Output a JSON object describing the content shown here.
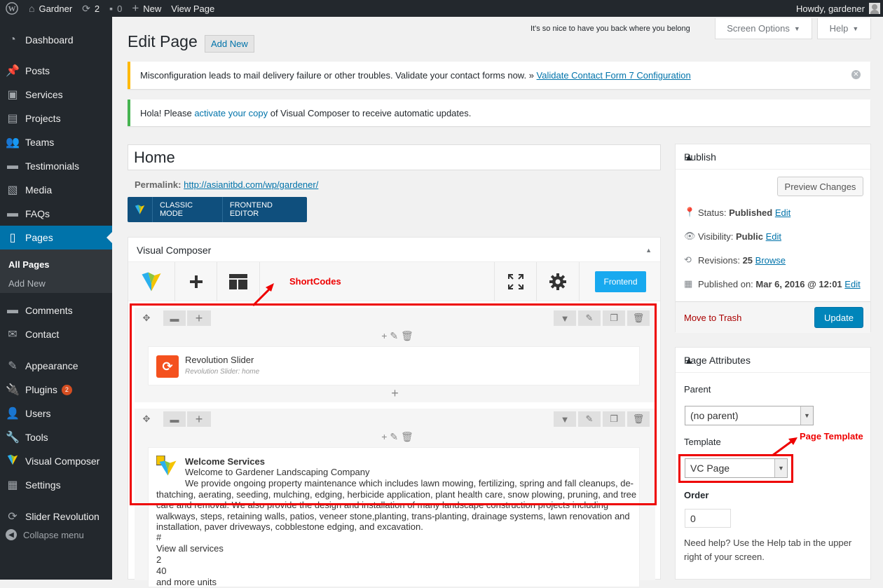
{
  "adminbar": {
    "site_name": "Gardner",
    "updates_count": "2",
    "comments_count": "0",
    "new_label": "New",
    "view_page": "View Page",
    "howdy": "Howdy, gardener"
  },
  "sidebar": {
    "items": [
      {
        "label": "Dashboard",
        "icon": "dashboard-icon"
      },
      {
        "label": "Posts",
        "icon": "pin-icon"
      },
      {
        "label": "Services",
        "icon": "briefcase-icon"
      },
      {
        "label": "Projects",
        "icon": "portfolio-icon"
      },
      {
        "label": "Teams",
        "icon": "groups-icon"
      },
      {
        "label": "Testimonials",
        "icon": "comment-icon"
      },
      {
        "label": "Media",
        "icon": "media-icon"
      },
      {
        "label": "FAQs",
        "icon": "comment-icon"
      },
      {
        "label": "Pages",
        "icon": "page-icon"
      },
      {
        "label": "Comments",
        "icon": "comment-icon"
      },
      {
        "label": "Contact",
        "icon": "mail-icon"
      },
      {
        "label": "Appearance",
        "icon": "brush-icon"
      },
      {
        "label": "Plugins",
        "icon": "plugin-icon",
        "badge": "2"
      },
      {
        "label": "Users",
        "icon": "user-icon"
      },
      {
        "label": "Tools",
        "icon": "wrench-icon"
      },
      {
        "label": "Visual Composer",
        "icon": "vc-logo-icon"
      },
      {
        "label": "Settings",
        "icon": "settings-icon"
      },
      {
        "label": "Slider Revolution",
        "icon": "refresh-icon"
      }
    ],
    "submenu": [
      "All Pages",
      "Add New"
    ],
    "collapse": "Collapse menu"
  },
  "header": {
    "welcome_note": "It's so nice to have you back where you belong",
    "screen_options": "Screen Options",
    "help": "Help",
    "title": "Edit Page",
    "add_new": "Add New"
  },
  "notices": {
    "warning_text": "Misconfiguration leads to mail delivery failure or other troubles. Validate your contact forms now. » ",
    "warning_link": "Validate Contact Form 7 Configuration",
    "success_pre": "Hola! Please ",
    "success_link": "activate your copy",
    "success_post": " of Visual Composer to receive automatic updates."
  },
  "editor": {
    "title_value": "Home",
    "permalink_label": "Permalink:",
    "permalink_url": "http://asianitbd.com/wp/gardener/",
    "classic_mode": "CLASSIC MODE",
    "frontend_editor": "FRONTEND EDITOR"
  },
  "vc": {
    "panel_title": "Visual Composer",
    "frontend_btn": "Frontend",
    "rows": [
      {
        "element_title": "Revolution Slider",
        "element_sub": "Revolution Slider: home"
      },
      {
        "element_title": "Welcome Services",
        "element_lines": [
          "Welcome to Gardener Landscaping Company",
          "We provide ongoing property maintenance which includes lawn mowing, fertilizing, spring and fall cleanups, de-thatching, aerating, seeding, mulching, edging, herbicide application, plant health care, snow plowing, pruning, and tree care and removal. We also provide the design and installation of many landscape construction projects including walkways, steps, retaining walls, patios, veneer stone,planting, trans-planting, drainage systems, lawn renovation and installation, paver driveways, cobblestone edging, and excavation.",
          "#",
          "View all services",
          "2",
          "40",
          "and more units"
        ]
      }
    ]
  },
  "annotations": {
    "shortcodes": "ShortCodes",
    "page_template": "Page Template",
    "color": "#ee0000"
  },
  "publish": {
    "title": "Publish",
    "preview": "Preview Changes",
    "status_label": "Status: ",
    "status_value": "Published",
    "visibility_label": "Visibility: ",
    "visibility_value": "Public",
    "revisions_label": "Revisions: ",
    "revisions_value": "25",
    "browse": "Browse",
    "published_label": "Published on: ",
    "published_value": "Mar 6, 2016 @ 12:01",
    "edit": "Edit",
    "trash": "Move to Trash",
    "update": "Update"
  },
  "page_attributes": {
    "title": "Page Attributes",
    "parent_label": "Parent",
    "parent_value": "(no parent)",
    "template_label": "Template",
    "template_value": "VC Page",
    "order_label": "Order",
    "order_value": "0",
    "help_text": "Need help? Use the Help tab in the upper right of your screen."
  },
  "colors": {
    "admin_dark": "#23282d",
    "wp_blue": "#0073aa",
    "annotation_red": "#ee0000",
    "vc_frontend": "#18a9ef"
  }
}
